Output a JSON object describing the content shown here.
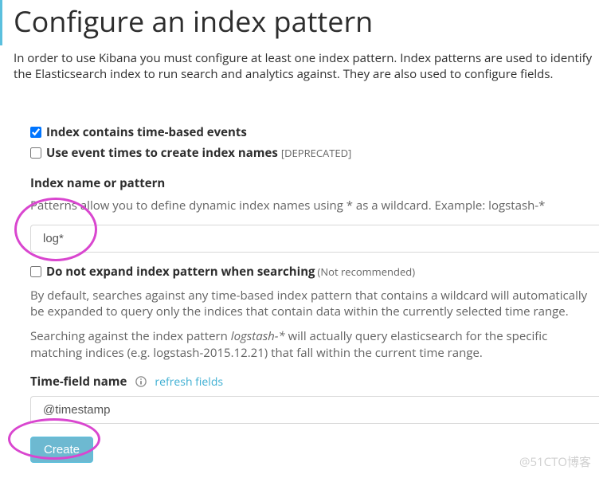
{
  "header": {
    "title": "Configure an index pattern"
  },
  "intro": "In order to use Kibana you must configure at least one index pattern. Index patterns are used to identify the Elasticsearch index to run search and analytics against. They are also used to configure fields.",
  "checkboxes": {
    "time_based": {
      "label": "Index contains time-based events",
      "checked": true
    },
    "event_times": {
      "label": "Use event times to create index names",
      "checked": false,
      "deprecated": "[DEPRECATED]"
    },
    "no_expand": {
      "label": "Do not expand index pattern when searching",
      "checked": false,
      "note": "(Not recommended)"
    }
  },
  "index_pattern": {
    "label": "Index name or pattern",
    "hint": "Patterns allow you to define dynamic index names using * as a wildcard. Example: logstash-*",
    "value": "log*"
  },
  "expand_help": {
    "p1": "By default, searches against any time-based index pattern that contains a wildcard will automatically be expanded to query only the indices that contain data within the currently selected time range.",
    "p2a": "Searching against the index pattern ",
    "p2_italic": "logstash-*",
    "p2b": " will actually query elasticsearch for the specific matching indices (e.g. logstash-2015.12.21) that fall within the current time range."
  },
  "time_field": {
    "label": "Time-field name",
    "refresh": "refresh fields",
    "value": "@timestamp"
  },
  "buttons": {
    "create": "Create"
  },
  "watermark": "@51CTO博客"
}
